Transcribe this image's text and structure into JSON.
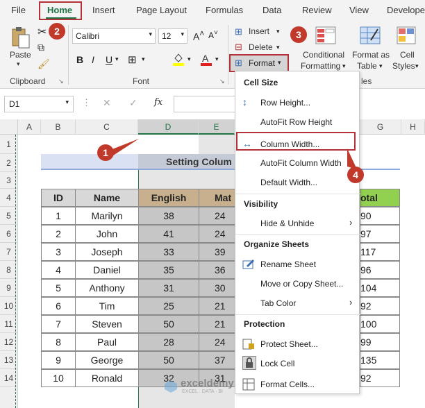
{
  "tabs": [
    "File",
    "Home",
    "Insert",
    "Page Layout",
    "Formulas",
    "Data",
    "Review",
    "View",
    "Develope"
  ],
  "ribbon": {
    "paste": "Paste",
    "clipboard": "Clipboard",
    "font_name": "Calibri",
    "font_size": "12",
    "font_group": "Font",
    "insert": "Insert",
    "delete": "Delete",
    "format": "Format",
    "conditional": [
      "Conditional",
      "Formatting"
    ],
    "format_as_table": [
      "Format as",
      "Table"
    ],
    "cell_styles": [
      "Cell",
      "Styles"
    ],
    "styles_tail": "les"
  },
  "formula_bar": {
    "name_box": "D1",
    "fx": "fx"
  },
  "columns": [
    "A",
    "B",
    "C",
    "D",
    "E",
    "F",
    "G",
    "H"
  ],
  "rows": [
    "1",
    "2",
    "3",
    "4",
    "5",
    "6",
    "7",
    "8",
    "9",
    "10",
    "11",
    "12",
    "13",
    "14"
  ],
  "title_cell": "Setting Colum",
  "table": {
    "headers": [
      "ID",
      "Name",
      "English",
      "Mat",
      "otal"
    ],
    "rows": [
      [
        "1",
        "Marilyn",
        "38",
        "24",
        "90"
      ],
      [
        "2",
        "John",
        "41",
        "24",
        "97"
      ],
      [
        "3",
        "Joseph",
        "33",
        "39",
        "117"
      ],
      [
        "4",
        "Daniel",
        "35",
        "36",
        "96"
      ],
      [
        "5",
        "Anthony",
        "31",
        "30",
        "104"
      ],
      [
        "6",
        "Tim",
        "25",
        "21",
        "92"
      ],
      [
        "7",
        "Steven",
        "50",
        "21",
        "100"
      ],
      [
        "8",
        "Paul",
        "28",
        "24",
        "99"
      ],
      [
        "9",
        "George",
        "50",
        "37",
        "135"
      ],
      [
        "10",
        "Ronald",
        "32",
        "31",
        "92"
      ]
    ]
  },
  "menu": {
    "cell_size": "Cell Size",
    "row_height": "Row Height...",
    "autofit_row": "AutoFit Row Height",
    "column_width": "Column Width...",
    "autofit_col": "AutoFit Column Width",
    "default_width": "Default Width...",
    "visibility": "Visibility",
    "hide_unhide": "Hide & Unhide",
    "organize": "Organize Sheets",
    "rename": "Rename Sheet",
    "move_copy": "Move or Copy Sheet...",
    "tab_color": "Tab Color",
    "protection": "Protection",
    "protect_sheet": "Protect Sheet...",
    "lock_cell": "Lock Cell",
    "format_cells": "Format Cells..."
  },
  "badges": [
    "1",
    "2",
    "3",
    "4"
  ],
  "watermark": "exceldemy",
  "watermark_sub": "EXCEL · DATA · BI",
  "colors": {
    "excel_green": "#217346",
    "accent_red": "#b5313a",
    "header_gray": "#d8d8d8",
    "tan": "#e0c9a6",
    "green_total": "#92d050"
  }
}
